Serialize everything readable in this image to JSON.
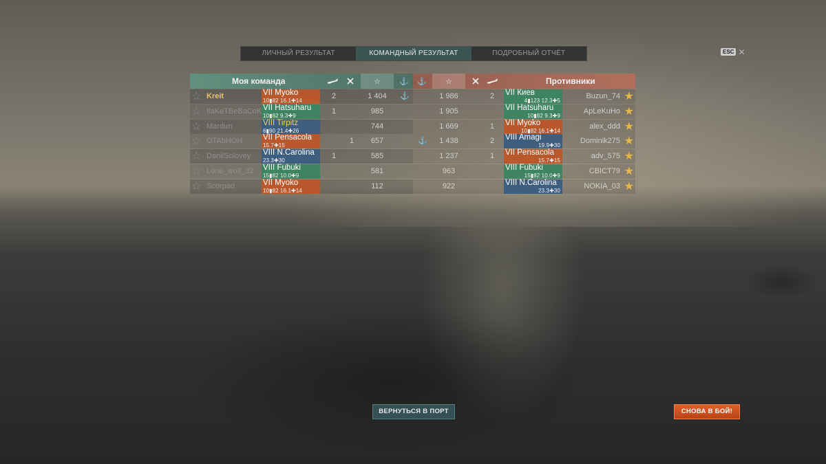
{
  "tabs": [
    {
      "label": "ЛИЧНЫЙ РЕЗУЛЬТАТ",
      "active": false
    },
    {
      "label": "КОМАНДНЫЙ РЕЗУЛЬТАТ",
      "active": true
    },
    {
      "label": "ПОДРОБНЫЙ ОТЧЁТ",
      "active": false
    }
  ],
  "esc": {
    "key": "ESC",
    "close": "✕"
  },
  "my_team": {
    "title": "Моя команда",
    "header_icons": {
      "plane": "plane-icon",
      "fighter": "fighter-icon",
      "star": "☆",
      "anchor": "⚓"
    },
    "players": [
      {
        "name": "Kreit",
        "ship": "VII Myoko",
        "stats": "10▮82  16.1✚14",
        "ship_color": "#b9582d",
        "planes": "2",
        "fighters": "",
        "xp": "1 404",
        "anchor": "⚓",
        "me": true
      },
      {
        "name": "IlaKeTBeBaCoK",
        "ship": "VII Hatsuharu",
        "stats": "10▮82  9.3✚9",
        "ship_color": "#3f8460",
        "planes": "1",
        "fighters": "",
        "xp": "985",
        "anchor": ""
      },
      {
        "name": "Mardun",
        "ship": "VIII Tirpitz",
        "stats": "6▮90  21.4✚26",
        "ship_color": "#3e5e80",
        "planes": "",
        "fighters": "",
        "xp": "744",
        "anchor": "",
        "ship_name_yellow": true
      },
      {
        "name": "OTAbHOH",
        "ship": "VII Pensacola",
        "stats": "15.7✚15",
        "ship_color": "#b9582d",
        "planes": "",
        "fighters": "1",
        "xp": "657",
        "anchor": ""
      },
      {
        "name": "DanilSolovey",
        "ship": "VIII N.Carolina",
        "stats": "23.3✚30",
        "ship_color": "#3e5e80",
        "planes": "1",
        "fighters": "",
        "xp": "585",
        "anchor": ""
      },
      {
        "name": "Lone_wolf_32",
        "ship": "VIII Fubuki",
        "stats": "15▮82  10.0✚9",
        "ship_color": "#3f8460",
        "planes": "",
        "fighters": "",
        "xp": "581",
        "anchor": ""
      },
      {
        "name": "Scorpad",
        "ship": "VII Myoko",
        "stats": "10▮82  16.1✚14",
        "ship_color": "#b9582d",
        "planes": "",
        "fighters": "",
        "xp": "112",
        "anchor": ""
      }
    ]
  },
  "enemy_team": {
    "title": "Противники",
    "players": [
      {
        "name": "Buzun_74",
        "ship": "VII Киев",
        "stats": "4▮123  12.3✚5",
        "ship_color": "#3f8460",
        "planes": "2",
        "xp": "1 986",
        "anchor": ""
      },
      {
        "name": "ApLeKuHo",
        "ship": "VII Hatsuharu",
        "stats": "10▮82  9.3✚9",
        "ship_color": "#3f8460",
        "planes": "",
        "xp": "1 905",
        "anchor": ""
      },
      {
        "name": "alex_ddd",
        "ship": "VII Myoko",
        "stats": "10▮82  16.1✚14",
        "ship_color": "#b9582d",
        "planes": "1",
        "xp": "1 669",
        "anchor": ""
      },
      {
        "name": "Dominik275",
        "ship": "VIII Amagi",
        "stats": "19.9✚30",
        "ship_color": "#3e5e80",
        "planes": "2",
        "xp": "1 438",
        "anchor": "⚓"
      },
      {
        "name": "adv_575",
        "ship": "VII Pensacola",
        "stats": "15.7✚15",
        "ship_color": "#b9582d",
        "planes": "1",
        "xp": "1 237",
        "anchor": ""
      },
      {
        "name": "CBICT79",
        "ship": "VIII Fubuki",
        "stats": "15▮82  10.0✚9",
        "ship_color": "#3f8460",
        "planes": "",
        "xp": "963",
        "anchor": ""
      },
      {
        "name": "NOKIA_03",
        "ship": "VIII N.Carolina",
        "stats": "23.3✚30",
        "ship_color": "#3e5e80",
        "planes": "",
        "xp": "922",
        "anchor": ""
      }
    ]
  },
  "buttons": {
    "port": "ВЕРНУТЬСЯ В ПОРТ",
    "again": "СНОВА В БОЙ!"
  },
  "colors": {
    "accent_green": "#5f9682",
    "accent_red": "#b96e5a",
    "gold_star": "#e7b648",
    "battle_button": "#d25524"
  }
}
